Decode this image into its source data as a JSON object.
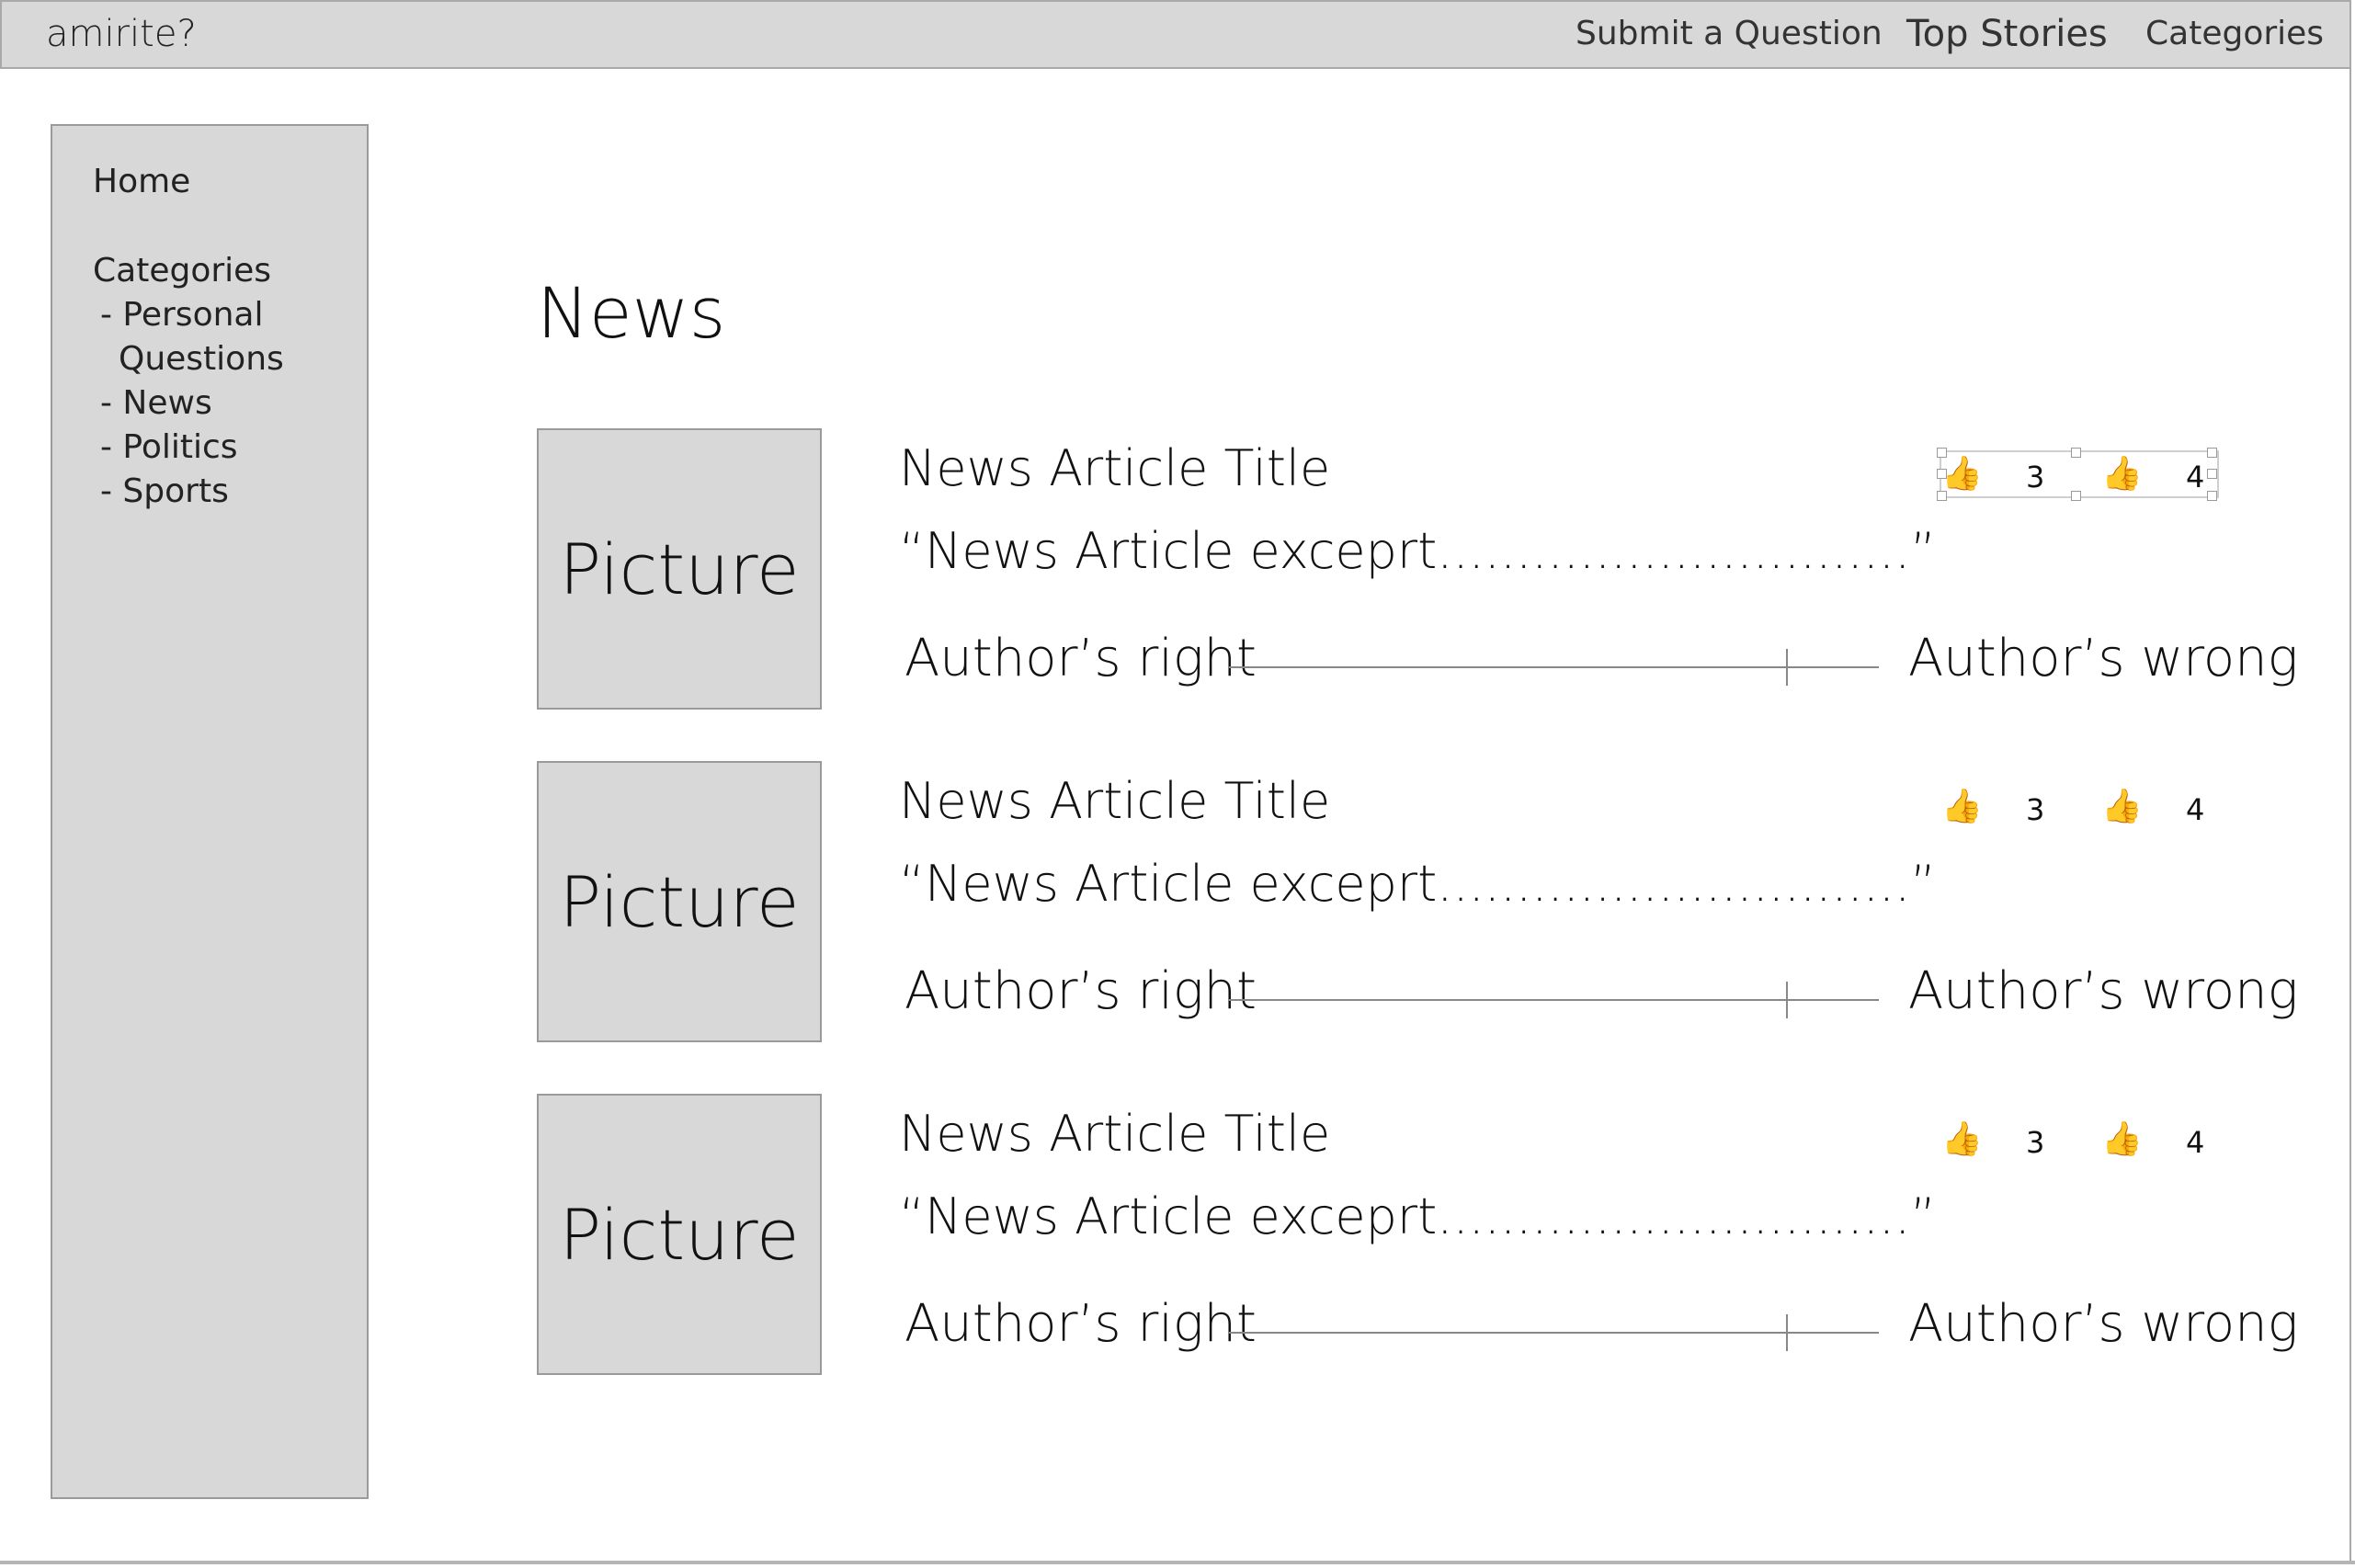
{
  "header": {
    "brand": "amirite?",
    "nav": [
      "Submit a Question",
      "Top Stories",
      "Categories"
    ]
  },
  "sidebar": {
    "home": "Home",
    "categories_label": "Categories",
    "items": [
      "- Personal",
      "Questions",
      "- News",
      "- Politics",
      "- Sports"
    ]
  },
  "main": {
    "title": "News",
    "articles": [
      {
        "picture_label": "Picture",
        "title": "News Article Title",
        "excerpt": "“News Article exceprt..............................”",
        "left_label": "Author’s right",
        "right_label": "Author’s wrong",
        "slider_value": 0.86,
        "up_count": "3",
        "down_count": "4",
        "selected": true
      },
      {
        "picture_label": "Picture",
        "title": "News Article Title",
        "excerpt": "“News Article exceprt..............................”",
        "left_label": "Author’s right",
        "right_label": "Author’s wrong",
        "slider_value": 0.86,
        "up_count": "3",
        "down_count": "4",
        "selected": false
      },
      {
        "picture_label": "Picture",
        "title": "News Article Title",
        "excerpt": "“News Article exceprt..............................”",
        "left_label": "Author’s right",
        "right_label": "Author’s wrong",
        "slider_value": 0.86,
        "up_count": "3",
        "down_count": "4",
        "selected": false
      }
    ]
  },
  "icons": {
    "vote": "thumbs-up-icon"
  }
}
